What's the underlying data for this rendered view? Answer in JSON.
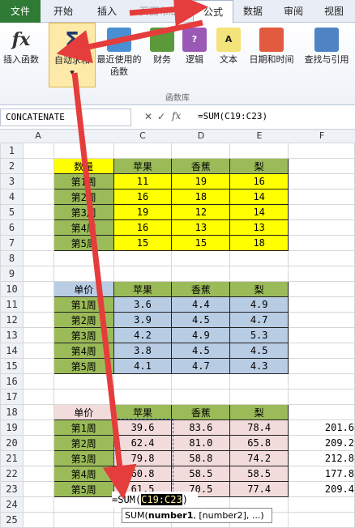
{
  "tabs": [
    "文件",
    "开始",
    "插入",
    "页面布局",
    "公式",
    "数据",
    "审阅",
    "视图"
  ],
  "ribbon": {
    "buttons": [
      {
        "label": "插入函数",
        "icon": "fx-icon"
      },
      {
        "label": "自动求和",
        "icon": "sigma-icon"
      },
      {
        "label": "最近使用的函数",
        "icon": "star-book-icon"
      },
      {
        "label": "财务",
        "icon": "finance-icon"
      },
      {
        "label": "逻辑",
        "icon": "logic-icon"
      },
      {
        "label": "文本",
        "icon": "text-icon"
      },
      {
        "label": "日期和时间",
        "icon": "calendar-icon"
      },
      {
        "label": "查找与引用",
        "icon": "lookup-icon"
      }
    ],
    "group_label": "函数库"
  },
  "formula_bar": {
    "name_box": "CONCATENATE",
    "formula": "=SUM(C19:C23)"
  },
  "columns": [
    "A",
    "C",
    "D",
    "E",
    "F"
  ],
  "rows": [
    {
      "n": "1",
      "cells": [
        "",
        "",
        "",
        "",
        ""
      ]
    },
    {
      "n": "2",
      "cells": [
        "",
        "数量",
        "苹果",
        "香蕉",
        "梨"
      ]
    },
    {
      "n": "3",
      "cells": [
        "",
        "第1周",
        "11",
        "19",
        "16"
      ]
    },
    {
      "n": "4",
      "cells": [
        "",
        "第2周",
        "16",
        "18",
        "14"
      ]
    },
    {
      "n": "5",
      "cells": [
        "",
        "第3周",
        "19",
        "12",
        "14"
      ]
    },
    {
      "n": "6",
      "cells": [
        "",
        "第4周",
        "16",
        "13",
        "13"
      ]
    },
    {
      "n": "7",
      "cells": [
        "",
        "第5周",
        "15",
        "15",
        "18"
      ]
    },
    {
      "n": "8",
      "cells": [
        "",
        "",
        "",
        "",
        ""
      ]
    },
    {
      "n": "9",
      "cells": [
        "",
        "",
        "",
        "",
        ""
      ]
    },
    {
      "n": "10",
      "cells": [
        "",
        "单价",
        "苹果",
        "香蕉",
        "梨"
      ]
    },
    {
      "n": "11",
      "cells": [
        "",
        "第1周",
        "3.6",
        "4.4",
        "4.9"
      ]
    },
    {
      "n": "12",
      "cells": [
        "",
        "第2周",
        "3.9",
        "4.5",
        "4.7"
      ]
    },
    {
      "n": "13",
      "cells": [
        "",
        "第3周",
        "4.2",
        "4.9",
        "5.3"
      ]
    },
    {
      "n": "14",
      "cells": [
        "",
        "第4周",
        "3.8",
        "4.5",
        "4.5"
      ]
    },
    {
      "n": "15",
      "cells": [
        "",
        "第5周",
        "4.1",
        "4.7",
        "4.3"
      ]
    },
    {
      "n": "16",
      "cells": [
        "",
        "",
        "",
        "",
        ""
      ]
    },
    {
      "n": "17",
      "cells": [
        "",
        "",
        "",
        "",
        ""
      ]
    },
    {
      "n": "18",
      "cells": [
        "",
        "单价",
        "苹果",
        "香蕉",
        "梨"
      ]
    },
    {
      "n": "19",
      "cells": [
        "",
        "第1周",
        "39.6",
        "83.6",
        "78.4",
        "201.6"
      ]
    },
    {
      "n": "20",
      "cells": [
        "",
        "第2周",
        "62.4",
        "81.0",
        "65.8",
        "209.2"
      ]
    },
    {
      "n": "21",
      "cells": [
        "",
        "第3周",
        "79.8",
        "58.8",
        "74.2",
        "212.8"
      ]
    },
    {
      "n": "22",
      "cells": [
        "",
        "第4周",
        "60.8",
        "58.5",
        "58.5",
        "177.8"
      ]
    },
    {
      "n": "23",
      "cells": [
        "",
        "第5周",
        "61.5",
        "70.5",
        "77.4",
        "209.4"
      ]
    },
    {
      "n": "24",
      "cells": [
        "",
        "",
        "",
        "",
        ""
      ]
    },
    {
      "n": "25",
      "cells": [
        "",
        "",
        "",
        "",
        ""
      ]
    }
  ],
  "edit_cell": {
    "prefix": "=SUM(",
    "range": "C19:C23",
    "suffix": ")"
  },
  "tooltip": {
    "fn": "SUM(",
    "arg1": "number1",
    ",rest": ", [number2], ...)",
    "rest": ", [number2], ...)"
  }
}
